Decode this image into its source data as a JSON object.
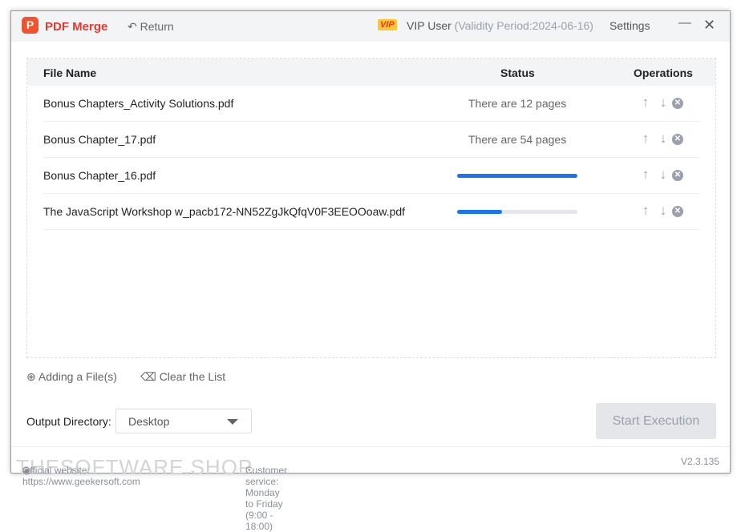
{
  "header": {
    "logo": "P",
    "title": "PDF Merge",
    "return": "Return",
    "vip_badge": "VIP",
    "vip_user": "VIP User",
    "validity": "(Validity Period:2024-06-16)",
    "settings": "Settings",
    "minimize": "—",
    "close": "✕"
  },
  "table": {
    "columns": [
      "File Name",
      "Status",
      "Operations"
    ],
    "rows": [
      {
        "name": "Bonus Chapters_Activity Solutions.pdf",
        "status": "There are 12 pages"
      },
      {
        "name": "Bonus Chapter_17.pdf",
        "status": "There are 54 pages"
      },
      {
        "name": "Bonus Chapter_16.pdf",
        "progress": 100
      },
      {
        "name": "The JavaScript Workshop w_pacb172-NN52ZgJkQfqV0F3EEOOoaw.pdf",
        "progress": 37
      }
    ],
    "op_icons": [
      "arrow-up-icon",
      "arrow-down-icon",
      "remove-icon"
    ]
  },
  "actions": {
    "add": "Adding a File(s)",
    "clear": "Clear the List"
  },
  "output": {
    "label": "Output Directory:",
    "value": "Desktop"
  },
  "start": "Start Execution",
  "footer": {
    "website": "Official website: https://www.geekersoft.com",
    "service": "Customer service: Monday to Friday (9:00 - 18:00)",
    "version": "V2.3.135",
    "watermark": "THESOFTWARE.SHOP"
  },
  "colors": {
    "accent": "#1a76f0",
    "brand": "#e8382d"
  }
}
